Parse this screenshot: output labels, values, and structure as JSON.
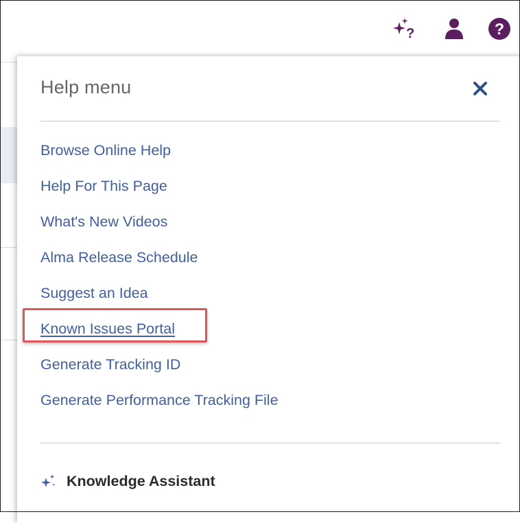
{
  "toolbar": {
    "icons": [
      "ai-sparkle-help-icon",
      "user-icon",
      "question-circle-icon"
    ],
    "icon_color": "#5b1f5f"
  },
  "help_menu": {
    "title": "Help menu",
    "close_icon": "close-x-icon",
    "items": [
      {
        "label": "Browse Online Help"
      },
      {
        "label": "Help For This Page"
      },
      {
        "label": "What's New Videos"
      },
      {
        "label": "Alma Release Schedule"
      },
      {
        "label": "Suggest an Idea"
      },
      {
        "label": "Known Issues Portal",
        "highlighted": true
      },
      {
        "label": "Generate Tracking ID"
      },
      {
        "label": "Generate Performance Tracking File"
      }
    ],
    "link_color": "#3f5fa6",
    "highlight_color": "#e05557",
    "knowledge_assistant": {
      "icon": "sparkle-icon",
      "label": "Knowledge Assistant"
    }
  }
}
